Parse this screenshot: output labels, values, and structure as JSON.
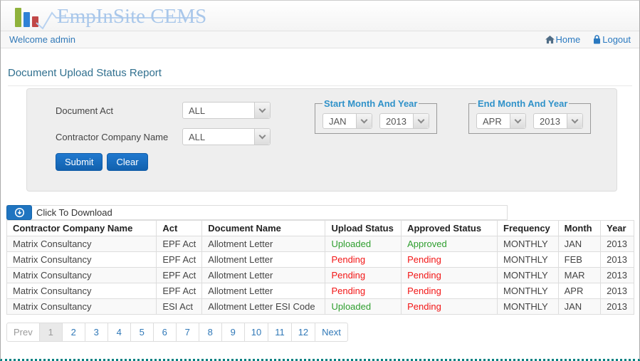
{
  "brand": {
    "title": "EmpInSite CEMS"
  },
  "topbar": {
    "welcome": "Welcome admin",
    "home_label": "Home",
    "logout_label": "Logout"
  },
  "page": {
    "title": "Document Upload Status Report"
  },
  "filters": {
    "document_act_label": "Document Act",
    "document_act_value": "ALL",
    "contractor_label": "Contractor Company Name",
    "contractor_value": "ALL",
    "start_group_label": "Start Month And Year",
    "start_month": "JAN",
    "start_year": "2013",
    "end_group_label": "End Month And Year",
    "end_month": "APR",
    "end_year": "2013",
    "submit_label": "Submit",
    "clear_label": "Clear"
  },
  "toolbar": {
    "download_label": "Click To Download"
  },
  "table": {
    "columns": [
      "Contractor Company Name",
      "Act",
      "Document Name",
      "Upload Status",
      "Approved Status",
      "Frequency",
      "Month",
      "Year"
    ],
    "rows": [
      {
        "company": "Matrix Consultancy",
        "act": "EPF Act",
        "document": "Allotment Letter",
        "upload_status": "Uploaded",
        "approved_status": "Approved",
        "frequency": "MONTHLY",
        "month": "JAN",
        "year": "2013"
      },
      {
        "company": "Matrix Consultancy",
        "act": "EPF Act",
        "document": "Allotment Letter",
        "upload_status": "Pending",
        "approved_status": "Pending",
        "frequency": "MONTHLY",
        "month": "FEB",
        "year": "2013"
      },
      {
        "company": "Matrix Consultancy",
        "act": "EPF Act",
        "document": "Allotment Letter",
        "upload_status": "Pending",
        "approved_status": "Pending",
        "frequency": "MONTHLY",
        "month": "MAR",
        "year": "2013"
      },
      {
        "company": "Matrix Consultancy",
        "act": "EPF Act",
        "document": "Allotment Letter",
        "upload_status": "Pending",
        "approved_status": "Pending",
        "frequency": "MONTHLY",
        "month": "APR",
        "year": "2013"
      },
      {
        "company": "Matrix Consultancy",
        "act": "ESI Act",
        "document": "Allotment Letter ESI Code",
        "upload_status": "Uploaded",
        "approved_status": "Pending",
        "frequency": "MONTHLY",
        "month": "JAN",
        "year": "2013"
      }
    ]
  },
  "pagination": {
    "prev": "Prev",
    "pages": [
      "1",
      "2",
      "3",
      "4",
      "5",
      "6",
      "7",
      "8",
      "9",
      "10",
      "11",
      "12"
    ],
    "next": "Next",
    "active_page": "1"
  },
  "colors": {
    "link_blue": "#3179b8",
    "legend_blue": "#3092c9",
    "button_blue": "#1a6fc4",
    "status_green": "#2e9e2e",
    "status_red": "#f21616",
    "bottom_dotted_teal": "#008080",
    "logo_bar_green": "#8fb23c",
    "logo_bar_blue": "#2f81d6",
    "logo_bar_red": "#c14747",
    "logo_text_blue": "#a9c7ea"
  }
}
